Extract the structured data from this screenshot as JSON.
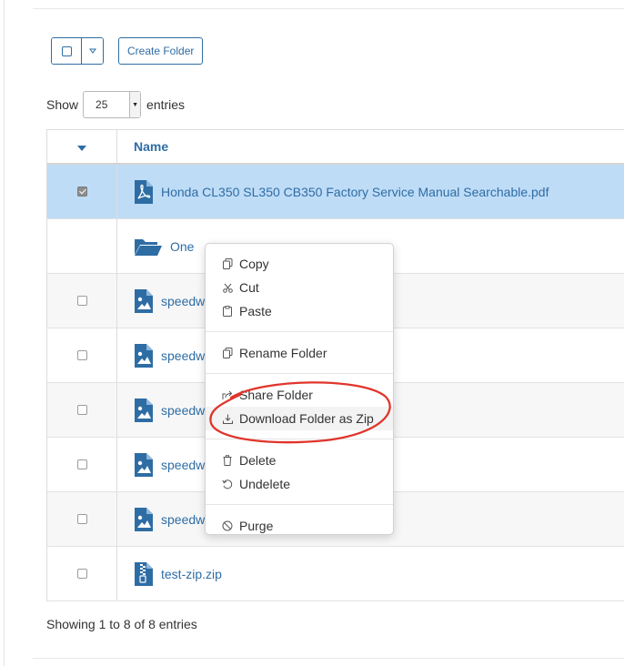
{
  "toolbar": {
    "create_folder_label": "Create Folder"
  },
  "length": {
    "show_label": "Show",
    "value": "25",
    "entries_label": "entries"
  },
  "table": {
    "header_name": "Name",
    "rows": [
      {
        "name": "Honda CL350 SL350 CB350 Factory Service Manual Searchable.pdf",
        "icon": "pdf-icon",
        "checked": true,
        "has_checkbox": true
      },
      {
        "name": "One",
        "icon": "folder-open-icon",
        "checked": false,
        "has_checkbox": false
      },
      {
        "name": "speedw",
        "icon": "image-file-icon",
        "checked": false,
        "has_checkbox": true
      },
      {
        "name": "speedw",
        "icon": "image-file-icon",
        "checked": false,
        "has_checkbox": true
      },
      {
        "name": "speedw",
        "icon": "image-file-icon",
        "checked": false,
        "has_checkbox": true
      },
      {
        "name": "speedw",
        "icon": "image-file-icon",
        "checked": false,
        "has_checkbox": true
      },
      {
        "name": "speedw",
        "icon": "image-file-icon",
        "checked": false,
        "has_checkbox": true
      },
      {
        "name": "test-zip.zip",
        "icon": "zip-file-icon",
        "checked": false,
        "has_checkbox": true
      }
    ]
  },
  "footer": {
    "info": "Showing 1 to 8 of 8 entries"
  },
  "context_menu": {
    "copy": "Copy",
    "cut": "Cut",
    "paste": "Paste",
    "rename": "Rename Folder",
    "share": "Share Folder",
    "download_zip": "Download Folder as Zip",
    "delete": "Delete",
    "undelete": "Undelete",
    "purge": "Purge"
  },
  "colors": {
    "accent": "#2e6da4",
    "selected_row": "#bfdcf7",
    "annotation": "#e0352b"
  }
}
